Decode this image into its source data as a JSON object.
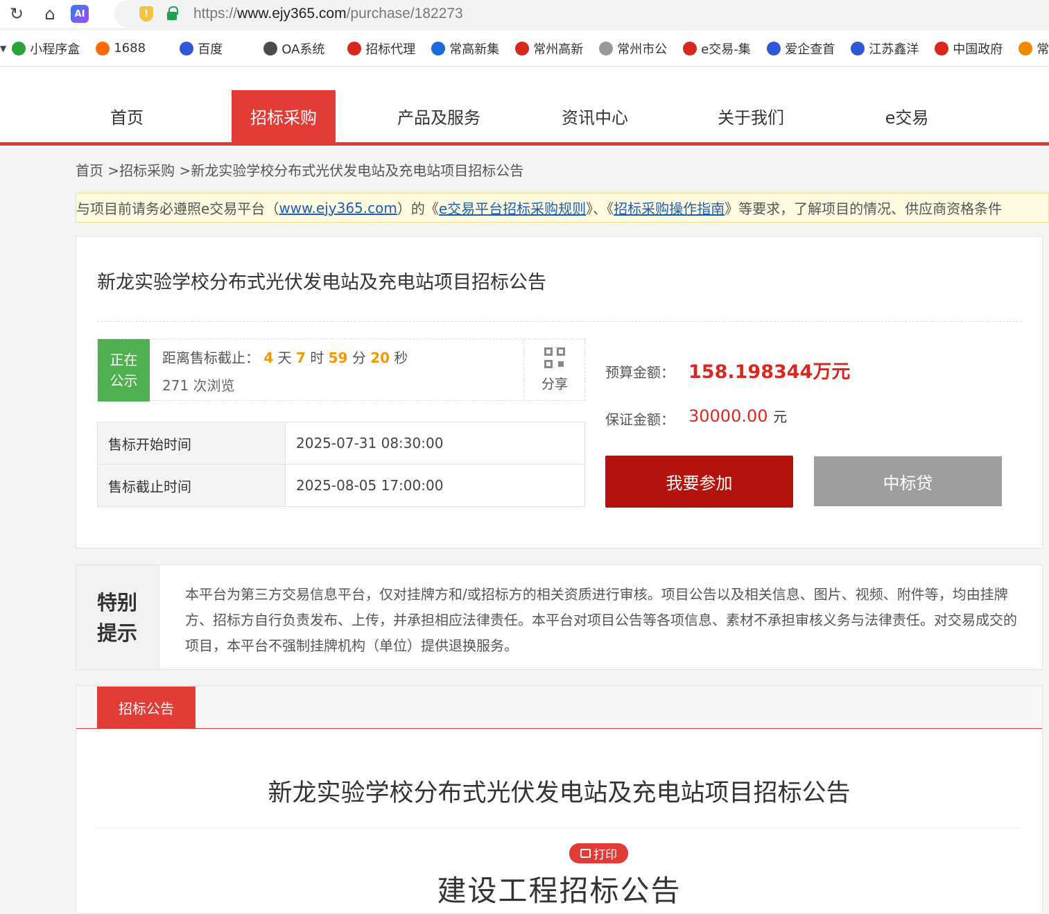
{
  "browser": {
    "url_prefix": "https://",
    "url_domain": "www.ejy365.com",
    "url_path": "/purchase/182273",
    "ai_badge": "AI",
    "bookmarks": [
      {
        "label": "小程序盒",
        "icon": "shield-green-icon",
        "color": "#2aa33a"
      },
      {
        "label": "1688",
        "icon": "alibaba-icon",
        "color": "#ff6a00"
      },
      {
        "label": "百度",
        "icon": "baidu-paw-icon",
        "color": "#2f57d8"
      },
      {
        "label": "OA系统",
        "icon": "oa-icon",
        "color": "#4b4b4b"
      },
      {
        "label": "招标代理",
        "icon": "pdf-icon",
        "color": "#d8281e"
      },
      {
        "label": "常高新集",
        "icon": "circle-c-icon",
        "color": "#1b6bd8"
      },
      {
        "label": "常州高新",
        "icon": "emblem-icon",
        "color": "#d8281e"
      },
      {
        "label": "常州市公",
        "icon": "globe-icon",
        "color": "#999999"
      },
      {
        "label": "e交易-集",
        "icon": "ejy-icon",
        "color": "#d8281e"
      },
      {
        "label": "爱企查首",
        "icon": "aiqicha-icon",
        "color": "#2f57d8"
      },
      {
        "label": "江苏鑫洋",
        "icon": "aiqicha-icon",
        "color": "#2f57d8"
      },
      {
        "label": "中国政府",
        "icon": "emblem-icon",
        "color": "#d8281e"
      },
      {
        "label": "常州市会",
        "icon": "orange-ring-icon",
        "color": "#f08a00"
      }
    ]
  },
  "site": {
    "nav": [
      {
        "label": "首页",
        "active": false
      },
      {
        "label": "招标采购",
        "active": true
      },
      {
        "label": "产品及服务",
        "active": false
      },
      {
        "label": "资讯中心",
        "active": false
      },
      {
        "label": "关于我们",
        "active": false
      },
      {
        "label": "e交易",
        "active": false
      }
    ],
    "accent": "#e33b36"
  },
  "breadcrumb": "首页 >招标采购 >新龙实验学校分布式光伏发电站及充电站项目招标公告",
  "notice": {
    "pre": "与项目前请务必遵照e交易平台（",
    "link1": "www.ejy365.com",
    "mid1": "）的《",
    "link2": "e交易平台招标采购规则",
    "mid2": "》、《",
    "link3": "招标采购操作指南",
    "post": "》等要求，了解项目的情况、供应商资格条件"
  },
  "project": {
    "title": "新龙实验学校分布式光伏发电站及充电站项目招标公告",
    "status_line1": "正在",
    "status_line2": "公示",
    "countdown_label": "距离售标截止：",
    "days": "4",
    "days_unit": "天",
    "hours": "7",
    "hours_unit": "时",
    "minutes": "59",
    "minutes_unit": "分",
    "seconds": "20",
    "seconds_unit": "秒",
    "views": "271 次浏览",
    "share_label": "分享",
    "sale_start_label": "售标开始时间",
    "sale_start": "2025-07-31 08:30:00",
    "sale_end_label": "售标截止时间",
    "sale_end": "2025-08-05 17:00:00",
    "budget_label": "预算金额：",
    "budget": "158.198344万元",
    "deposit_label": "保证金额：",
    "deposit": "30000.00",
    "deposit_unit": "元",
    "join_button": "我要参加",
    "loan_button": "中标贷"
  },
  "special": {
    "label_line1": "特别",
    "label_line2": "提示",
    "text": "本平台为第三方交易信息平台，仅对挂牌方和/或招标方的相关资质进行审核。项目公告以及相关信息、图片、视频、附件等，均由挂牌方、招标方自行负责发布、上传，并承担相应法律责任。本平台对项目公告等各项信息、素材不承担审核义务与法律责任。对交易成交的项目，本平台不强制挂牌机构（单位）提供退换服务。"
  },
  "announcement": {
    "tab": "招标公告",
    "title": "新龙实验学校分布式光伏发电站及充电站项目招标公告",
    "print": "打印",
    "subtitle": "建设工程招标公告"
  }
}
